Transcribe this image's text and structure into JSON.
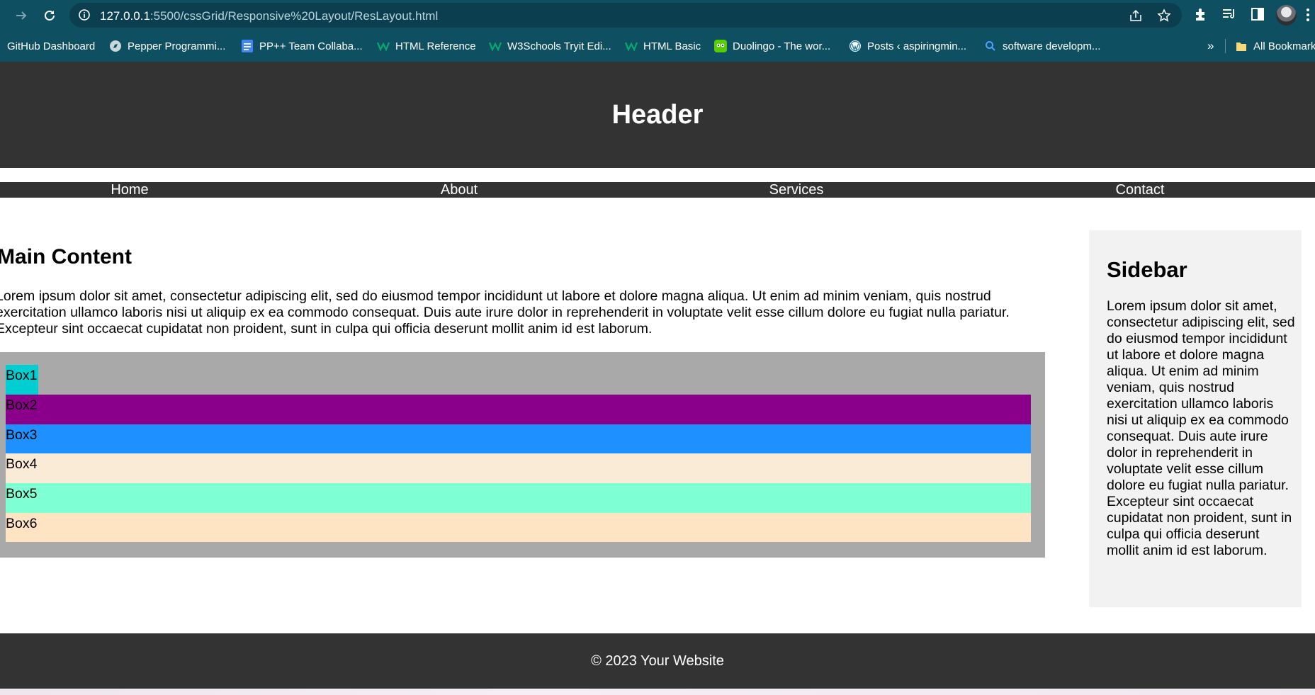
{
  "browser": {
    "url_host": "127.0.0.1",
    "url_path": ":5500/cssGrid/Responsive%20Layout/ResLayout.html",
    "bookmarks": [
      {
        "label": "GitHub Dashboard",
        "icon": "github-icon"
      },
      {
        "label": "Pepper Programmi...",
        "icon": "compass-icon"
      },
      {
        "label": "PP++ Team Collaba...",
        "icon": "docs-icon"
      },
      {
        "label": "HTML Reference",
        "icon": "w3-icon"
      },
      {
        "label": "W3Schools Tryit Edi...",
        "icon": "w3-icon"
      },
      {
        "label": "HTML Basic",
        "icon": "w3-icon"
      },
      {
        "label": "Duolingo - The wor...",
        "icon": "duolingo-icon"
      },
      {
        "label": "Posts ‹ aspiringmin...",
        "icon": "wordpress-icon"
      },
      {
        "label": "software developm...",
        "icon": "search-icon"
      }
    ],
    "overflow_label": "»",
    "all_bookmarks_label": "All Bookmarks"
  },
  "page": {
    "header_title": "Header",
    "nav": [
      "Home",
      "About",
      "Services",
      "Contact"
    ],
    "main_title": "Main Content",
    "main_text": "Lorem ipsum dolor sit amet, consectetur adipiscing elit, sed do eiusmod tempor incididunt ut labore et dolore magna aliqua. Ut enim ad minim veniam, quis nostrud exercitation ullamco laboris nisi ut aliquip ex ea commodo consequat. Duis aute irure dolor in reprehenderit in voluptate velit esse cillum dolore eu fugiat nulla pariatur. Excepteur sint occaecat cupidatat non proident, sunt in culpa qui officia deserunt mollit anim id est laborum.",
    "boxes": [
      {
        "label": "Box1",
        "color": "#00ced1"
      },
      {
        "label": "Box2",
        "color": "#8b008b"
      },
      {
        "label": "Box3",
        "color": "#1e90ff"
      },
      {
        "label": "Box4",
        "color": "#faebd7"
      },
      {
        "label": "Box5",
        "color": "#7fffd4"
      },
      {
        "label": "Box6",
        "color": "#ffe4c4"
      }
    ],
    "sidebar_title": "Sidebar",
    "sidebar_text": "Lorem ipsum dolor sit amet, consectetur adipiscing elit, sed do eiusmod tempor incididunt ut labore et dolore magna aliqua. Ut enim ad minim veniam, quis nostrud exercitation ullamco laboris nisi ut aliquip ex ea commodo consequat. Duis aute irure dolor in reprehenderit in voluptate velit esse cillum dolore eu fugiat nulla pariatur. Excepteur sint occaecat cupidatat non proident, sunt in culpa qui officia deserunt mollit anim id est laborum.",
    "footer_text": "© 2023 Your Website"
  },
  "colors": {
    "chrome": "#0f4f62",
    "page_dark": "#333333",
    "grid_bg": "#a9a9a9",
    "sidebar_bg": "#f2f2f2"
  }
}
